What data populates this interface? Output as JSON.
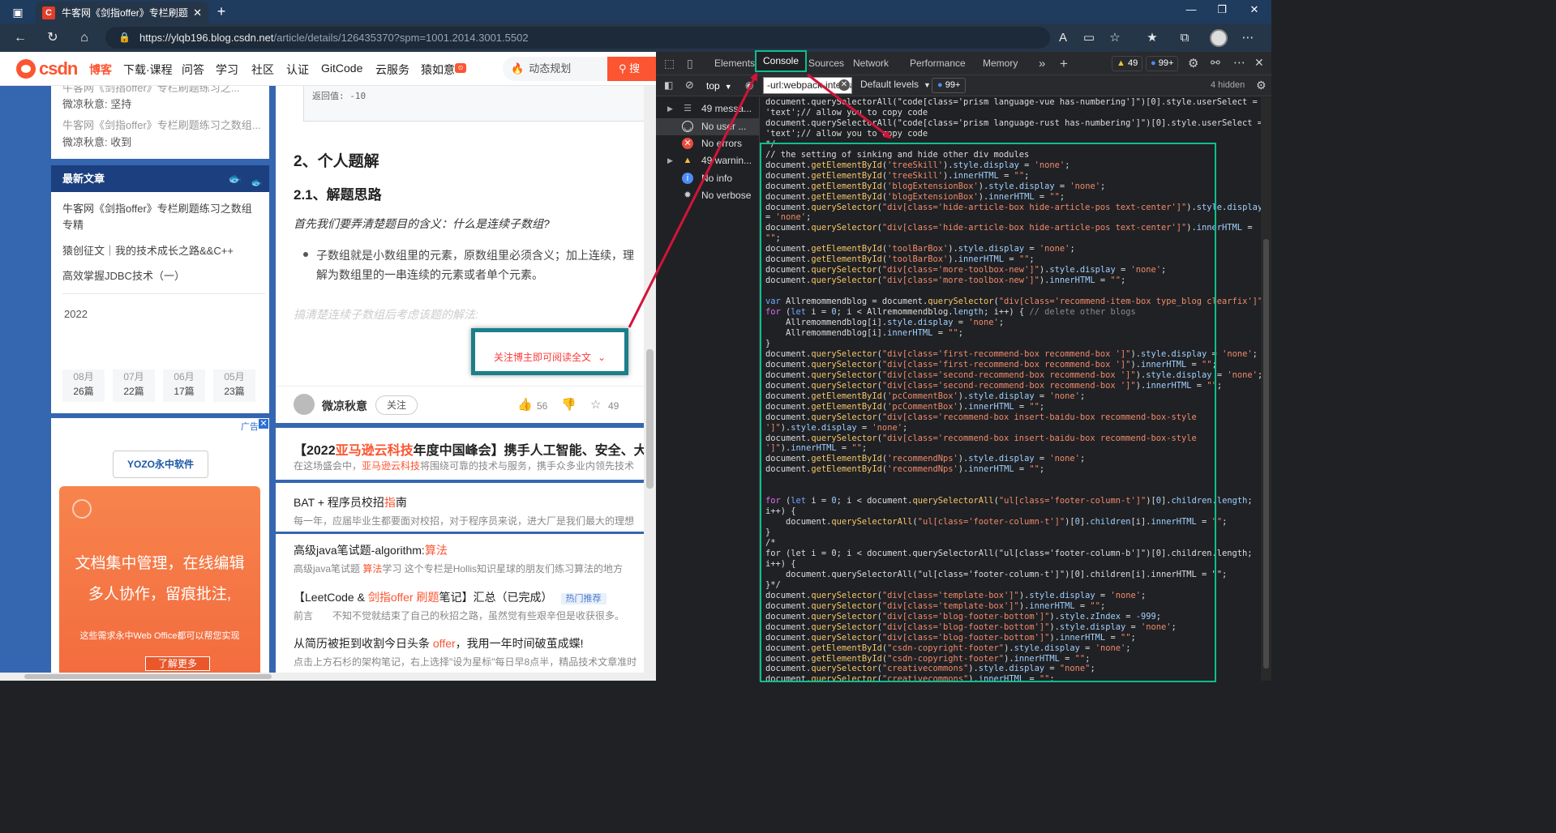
{
  "browser": {
    "tab_title": "牛客网《剑指offer》专栏刷题练",
    "tab_favicon_letter": "C",
    "url_host": "https://ylqb196.blog.csdn.net",
    "url_path": "/article/details/126435370?spm=1001.2014.3001.5502"
  },
  "csdn": {
    "logo_text": "csdn",
    "nav": [
      "博客",
      "下载·课程",
      "问答",
      "学习",
      "社区",
      "认证",
      "GitCode",
      "云服务",
      "猿如意"
    ],
    "search_placeholder": "动态规划",
    "search_button": "搜"
  },
  "sidebar": {
    "top_items": [
      {
        "text": "牛客网《剑指offer》专栏刷题练习之...",
        "gray": true
      },
      {
        "text": "微凉秋意: 坚持",
        "gray": false
      },
      {
        "text": "牛客网《剑指offer》专栏刷题练习之数组...",
        "gray": true
      },
      {
        "text": "微凉秋意: 收到",
        "gray": false
      }
    ],
    "newest_title": "最新文章",
    "articles": [
      "牛客网《剑指offer》专栏刷题练习之数组专精",
      "猿创征文｜我的技术成长之路&&C++",
      "高效掌握JDBC技术（一）"
    ],
    "year": "2022",
    "archives": [
      {
        "month": "08月",
        "count": "26篇"
      },
      {
        "month": "07月",
        "count": "22篇"
      },
      {
        "month": "06月",
        "count": "17篇"
      },
      {
        "month": "05月",
        "count": "23篇"
      }
    ],
    "ad_label": "广告",
    "ad_brand": "YOZO永中软件",
    "ad_line1": "文档集中管理，在线编辑",
    "ad_line2": "多人协作，留痕批注,",
    "ad_line3": "这些需求永中Web Office都可以帮您实现",
    "ad_button": "了解更多"
  },
  "article": {
    "return_value": "返回值: -10",
    "h2": "2、个人题解",
    "h3": "2.1、解题思路",
    "italic": "首先我们要弄清楚题目的含义：什么是连续子数组?",
    "bullet": "子数组就是小数组里的元素，原数组里必须含义；加上连续，理解为数组里的一串连续的元素或者单个元素。",
    "faded": "搞清楚连续子数组后考虑该题的解法:",
    "follow_to_read": "关注博主即可阅读全文",
    "author": "微凉秋意",
    "follow_button": "关注",
    "likes": "56",
    "stars": "49",
    "rec": [
      {
        "title_pre": "【2022",
        "title_hl": "亚马逊云科技",
        "title_post": "年度中国峰会】携手人工智能、安全、大",
        "desc_pre": "在这场盛会中，",
        "desc_hl": "亚马逊云科技",
        "desc_post": "将围绕可靠的技术与服务，携手众多业内领先技术"
      },
      {
        "title_pre": "BAT + 程序员校招",
        "title_hl": "指",
        "title_post": "南",
        "desc_pre": "每一年，应届毕业生都要面对校招，对于程序员来说，进大厂是我们最大的理想",
        "desc_hl": "",
        "desc_post": ""
      },
      {
        "title_pre": "高级java笔试题-algorithm:",
        "title_hl": "算法",
        "title_post": "",
        "desc_pre": "高级java笔试题 ",
        "desc_hl": "算法",
        "desc_post": "学习 这个专栏是Hollis知识星球的朋友们练习算法的地方"
      },
      {
        "title_pre": "【LeetCode & ",
        "title_hl": "剑指offer 刷题",
        "title_post": "笔记】汇总（已完成）",
        "badge": "热门推荐",
        "desc_pre": "前言　　不知不觉就结束了自己的秋招之路，虽然觉有些艰辛但是收获很多。",
        "desc_hl": "",
        "desc_post": ""
      },
      {
        "title_pre": "从简历被拒到收割今日头条 ",
        "title_hl": "offer",
        "title_post": "，我用一年时间破茧成蝶!",
        "desc_pre": "点击上方石杉的架构笔记，右上选择\"设为星标\"每日早8点半，精品技术文章准时",
        "desc_hl": "",
        "desc_post": ""
      }
    ]
  },
  "devtools": {
    "tabs": [
      "Elements",
      "Console",
      "Sources",
      "Network",
      "Performance",
      "Memory"
    ],
    "warnings_badge": "49",
    "issues_badge": "99+",
    "context": "top",
    "filter_value": "-url:webpack-internal",
    "levels": "Default levels",
    "issues_chip": "99+",
    "hidden": "4 hidden",
    "side": [
      {
        "label": "49 messa...",
        "icon": "list"
      },
      {
        "label": "No user ...",
        "icon": "user"
      },
      {
        "label": "No errors",
        "icon": "error"
      },
      {
        "label": "49 warnin...",
        "icon": "warning"
      },
      {
        "label": "No info",
        "icon": "info"
      },
      {
        "label": "No verbose",
        "icon": "bug"
      }
    ],
    "accent": "#0bbf8f",
    "arrow_color": "#d1143a"
  }
}
